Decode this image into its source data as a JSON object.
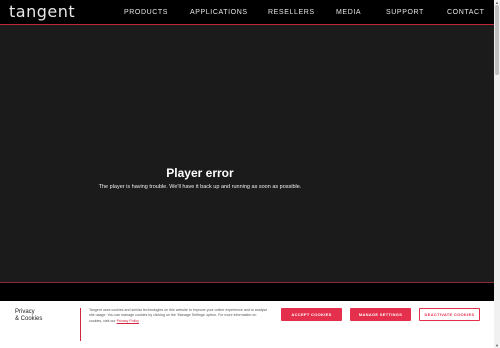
{
  "nav": {
    "logo": "tangent",
    "items": [
      "PRODUCTS",
      "APPLICATIONS",
      "RESELLERS",
      "MEDIA",
      "SUPPORT",
      "CONTACT"
    ]
  },
  "player": {
    "error_title": "Player error",
    "error_message": "The player is having trouble. We'll have it back up and running as soon as possible."
  },
  "cookies": {
    "title_line1": "Privacy",
    "title_line2": "& Cookies",
    "text": "Tangent uses cookies and similar technologies on this website to improve your online experience and to analyse site usage. You can manage cookies by clicking on the 'Manage Settings' option. For more information on cookies, visit our ",
    "policy_link": "Privacy Policy",
    "accept_label": "ACCEPT COOKIES",
    "manage_label": "MANAGE SETTINGS",
    "deactivate_label": "DEACTIVATE COOKIES"
  },
  "colors": {
    "accent": "#e5304d",
    "nav_background": "#000000",
    "player_background": "#1b1b1b"
  }
}
